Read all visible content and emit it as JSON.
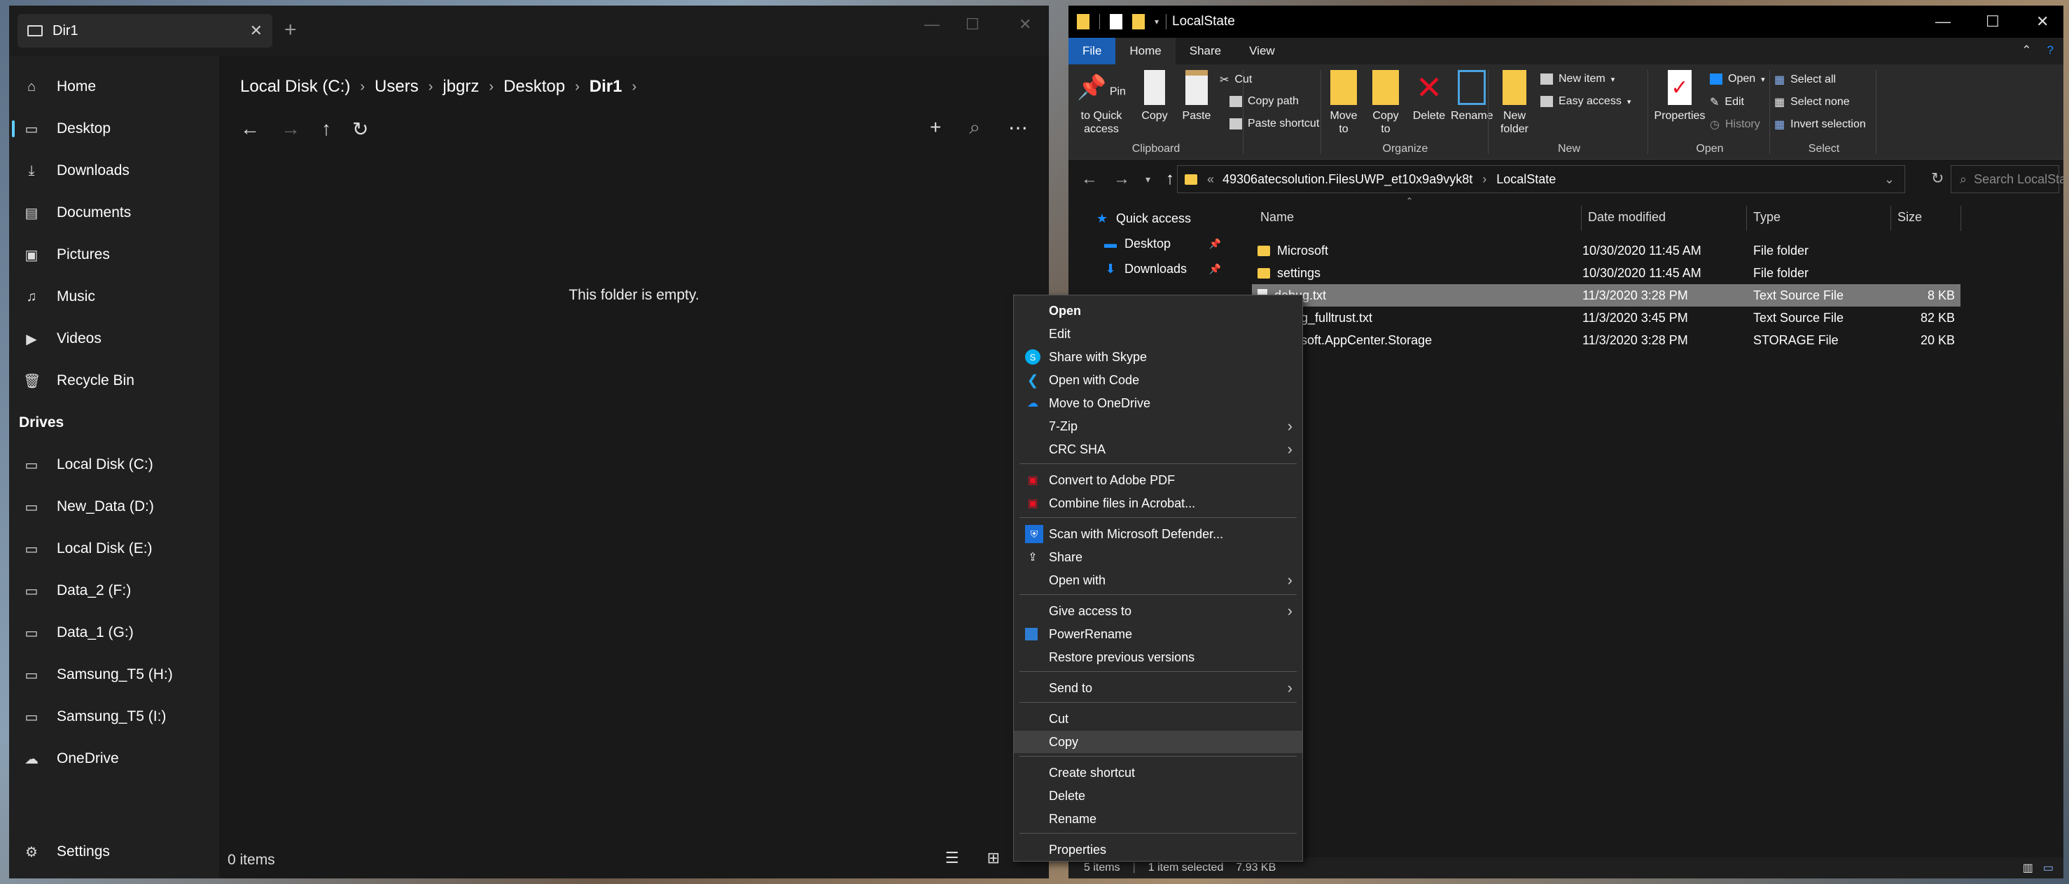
{
  "files_window": {
    "tab_title": "Dir1",
    "sidebar": [
      {
        "label": "Home",
        "icon": "home-icon"
      },
      {
        "label": "Desktop",
        "icon": "desktop-icon"
      },
      {
        "label": "Downloads",
        "icon": "download-icon"
      },
      {
        "label": "Documents",
        "icon": "document-icon"
      },
      {
        "label": "Pictures",
        "icon": "picture-icon"
      },
      {
        "label": "Music",
        "icon": "music-icon"
      },
      {
        "label": "Videos",
        "icon": "video-icon"
      },
      {
        "label": "Recycle Bin",
        "icon": "recycle-bin-icon"
      }
    ],
    "drives_header": "Drives",
    "drives": [
      "Local Disk (C:)",
      "New_Data (D:)",
      "Local Disk (E:)",
      "Data_2 (F:)",
      "Data_1 (G:)",
      "Samsung_T5 (H:)",
      "Samsung_T5 (I:)",
      "OneDrive"
    ],
    "settings_label": "Settings",
    "breadcrumb": [
      "Local Disk (C:)",
      "Users",
      "jbgrz",
      "Desktop",
      "Dir1"
    ],
    "empty_message": "This folder is empty.",
    "status": "0 items"
  },
  "explorer_window": {
    "title": "LocalState",
    "ribbon_tabs": [
      "File",
      "Home",
      "Share",
      "View"
    ],
    "ribbon": {
      "clipboard": {
        "label": "Clipboard",
        "pin": "Pin to Quick access",
        "copy": "Copy",
        "paste": "Paste",
        "cut": "Cut",
        "copy_path": "Copy path",
        "paste_shortcut": "Paste shortcut"
      },
      "organize": {
        "label": "Organize",
        "move_to": "Move to",
        "copy_to": "Copy to",
        "delete": "Delete",
        "rename": "Rename"
      },
      "new": {
        "label": "New",
        "new_folder": "New folder",
        "new_item": "New item",
        "easy_access": "Easy access"
      },
      "open": {
        "label": "Open",
        "properties": "Properties",
        "open": "Open",
        "edit": "Edit",
        "history": "History"
      },
      "select": {
        "label": "Select",
        "select_all": "Select all",
        "select_none": "Select none",
        "invert_selection": "Invert selection"
      }
    },
    "address": {
      "prefix": "«",
      "segments": [
        "49306atecsolution.FilesUWP_et10x9a9vyk8t",
        "LocalState"
      ]
    },
    "search_placeholder": "Search LocalState",
    "nav": {
      "quick_access": "Quick access",
      "items": [
        "Desktop",
        "Downloads"
      ]
    },
    "columns": [
      "Name",
      "Date modified",
      "Type",
      "Size"
    ],
    "files": [
      {
        "name": "Microsoft",
        "date": "10/30/2020 11:45 AM",
        "type": "File folder",
        "size": "",
        "kind": "folder"
      },
      {
        "name": "settings",
        "date": "10/30/2020 11:45 AM",
        "type": "File folder",
        "size": "",
        "kind": "folder"
      },
      {
        "name": "debug.txt",
        "date": "11/3/2020 3:28 PM",
        "type": "Text Source File",
        "size": "8 KB",
        "kind": "file"
      },
      {
        "name": "ug_fulltrust.txt",
        "date": "11/3/2020 3:45 PM",
        "type": "Text Source File",
        "size": "82 KB",
        "kind": "file"
      },
      {
        "name": "osoft.AppCenter.Storage",
        "date": "11/3/2020 3:28 PM",
        "type": "STORAGE File",
        "size": "20 KB",
        "kind": "file"
      }
    ],
    "status": {
      "count": "5 items",
      "selected": "1 item selected",
      "size": "7.93 KB"
    }
  },
  "context_menu": [
    {
      "label": "Open",
      "bold": true
    },
    {
      "label": "Edit"
    },
    {
      "label": "Share with Skype",
      "icon": "skype-icon"
    },
    {
      "label": "Open with Code",
      "icon": "vscode-icon"
    },
    {
      "label": "Move to OneDrive",
      "icon": "onedrive-icon"
    },
    {
      "label": "7-Zip",
      "submenu": true
    },
    {
      "label": "CRC SHA",
      "submenu": true
    },
    {
      "label": "Convert to Adobe PDF",
      "icon": "adobe-pdf-icon"
    },
    {
      "label": "Combine files in Acrobat...",
      "icon": "acrobat-icon"
    },
    {
      "label": "Scan with Microsoft Defender...",
      "icon": "defender-icon"
    },
    {
      "label": "Share",
      "icon": "share-icon"
    },
    {
      "label": "Open with",
      "submenu": true
    },
    {
      "label": "Give access to",
      "submenu": true
    },
    {
      "label": "PowerRename",
      "icon": "powerrename-icon"
    },
    {
      "label": "Restore previous versions"
    },
    {
      "label": "Send to",
      "submenu": true
    },
    {
      "label": "Cut"
    },
    {
      "label": "Copy",
      "hover": true
    },
    {
      "label": "Create shortcut"
    },
    {
      "label": "Delete"
    },
    {
      "label": "Rename"
    },
    {
      "label": "Properties"
    }
  ],
  "colors": {
    "accent": "#60cdff",
    "file_tab_blue": "#1a5fb4",
    "folder_yellow": "#f7c948",
    "delete_red": "#e81123"
  }
}
